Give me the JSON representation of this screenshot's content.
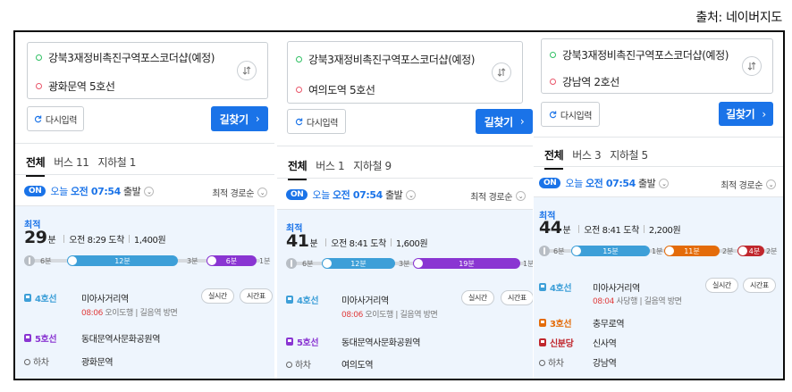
{
  "source_label": "출처: 네이버지도",
  "panels": [
    {
      "origin": "강북3재정비촉진구역포스코더샵(예정)",
      "destination": "광화문역 5호선",
      "reset_label": "다시입력",
      "find_label": "길찾기",
      "tabs": [
        "전체",
        "버스 11",
        "지하철 1"
      ],
      "on_label": "ON",
      "day_label": "오늘",
      "depart_time": "오전 07:54",
      "depart_suffix": "출발",
      "sort_label": "최적 경로순",
      "best_label": "최적",
      "minutes": "29",
      "minutes_unit": "분",
      "arrive": "오전 8:29 도착",
      "fare": "1,400원",
      "timeline": {
        "walk1": "6분",
        "seg1": "12분",
        "walk2": "3분",
        "seg2": "6분",
        "walk3": "1분",
        "seg1_color": "#3d9fd8",
        "seg2_color": "#8a35d2"
      },
      "steps": [
        {
          "line": "4호선",
          "color": "#3d9fd8",
          "station": "미아사거리역",
          "time": "08:06",
          "detail": "오이도행 | 길음역 방면",
          "btn1": "실시간",
          "btn2": "시간표"
        },
        {
          "line": "5호선",
          "color": "#8a35d2",
          "station": "동대문역사문화공원역"
        }
      ],
      "alight_label": "하차",
      "alight_station": "광화문역"
    },
    {
      "origin": "강북3재정비촉진구역포스코더샵(예정)",
      "destination": "여의도역 5호선",
      "reset_label": "다시입력",
      "find_label": "길찾기",
      "tabs": [
        "전체",
        "버스 1",
        "지하철 9"
      ],
      "on_label": "ON",
      "day_label": "오늘",
      "depart_time": "오전 07:54",
      "depart_suffix": "출발",
      "sort_label": "최적 경로순",
      "best_label": "최적",
      "minutes": "41",
      "minutes_unit": "분",
      "arrive": "오전 8:41 도착",
      "fare": "1,600원",
      "timeline": {
        "walk1": "6분",
        "seg1": "12분",
        "walk2": "3분",
        "seg2": "19분",
        "walk3": "1분",
        "seg1_color": "#3d9fd8",
        "seg2_color": "#8a35d2"
      },
      "steps": [
        {
          "line": "4호선",
          "color": "#3d9fd8",
          "station": "미아사거리역",
          "time": "08:06",
          "detail": "오이도행 | 길음역 방면",
          "btn1": "실시간",
          "btn2": "시간표"
        },
        {
          "line": "5호선",
          "color": "#8a35d2",
          "station": "동대문역사문화공원역"
        }
      ],
      "alight_label": "하차",
      "alight_station": "여의도역"
    },
    {
      "origin": "강북3재정비촉진구역포스코더샵(예정)",
      "destination": "강남역 2호선",
      "reset_label": "다시입력",
      "find_label": "길찾기",
      "tabs": [
        "전체",
        "버스 3",
        "지하철 5"
      ],
      "on_label": "ON",
      "day_label": "오늘",
      "depart_time": "오전 07:54",
      "depart_suffix": "출발",
      "sort_label": "최적 경로순",
      "best_label": "최적",
      "minutes": "44",
      "minutes_unit": "분",
      "arrive": "오전 8:41 도착",
      "fare": "2,200원",
      "timeline": {
        "walk1": "6분",
        "seg1": "15분",
        "walk2": "1분",
        "seg2": "11분",
        "walk3": "2분",
        "seg3": "4분",
        "walk4": "2분",
        "seg1_color": "#3d9fd8",
        "seg2_color": "#e46c0a",
        "seg3_color": "#c0272d"
      },
      "steps": [
        {
          "line": "4호선",
          "color": "#3d9fd8",
          "station": "미아사거리역",
          "time": "08:04",
          "detail": "사당행 | 길음역 방면",
          "btn1": "실시간",
          "btn2": "시간표"
        },
        {
          "line": "3호선",
          "color": "#e46c0a",
          "station": "충무로역"
        },
        {
          "line": "신분당",
          "color": "#c0272d",
          "station": "신사역"
        }
      ],
      "alight_label": "하차",
      "alight_station": "강남역"
    }
  ]
}
